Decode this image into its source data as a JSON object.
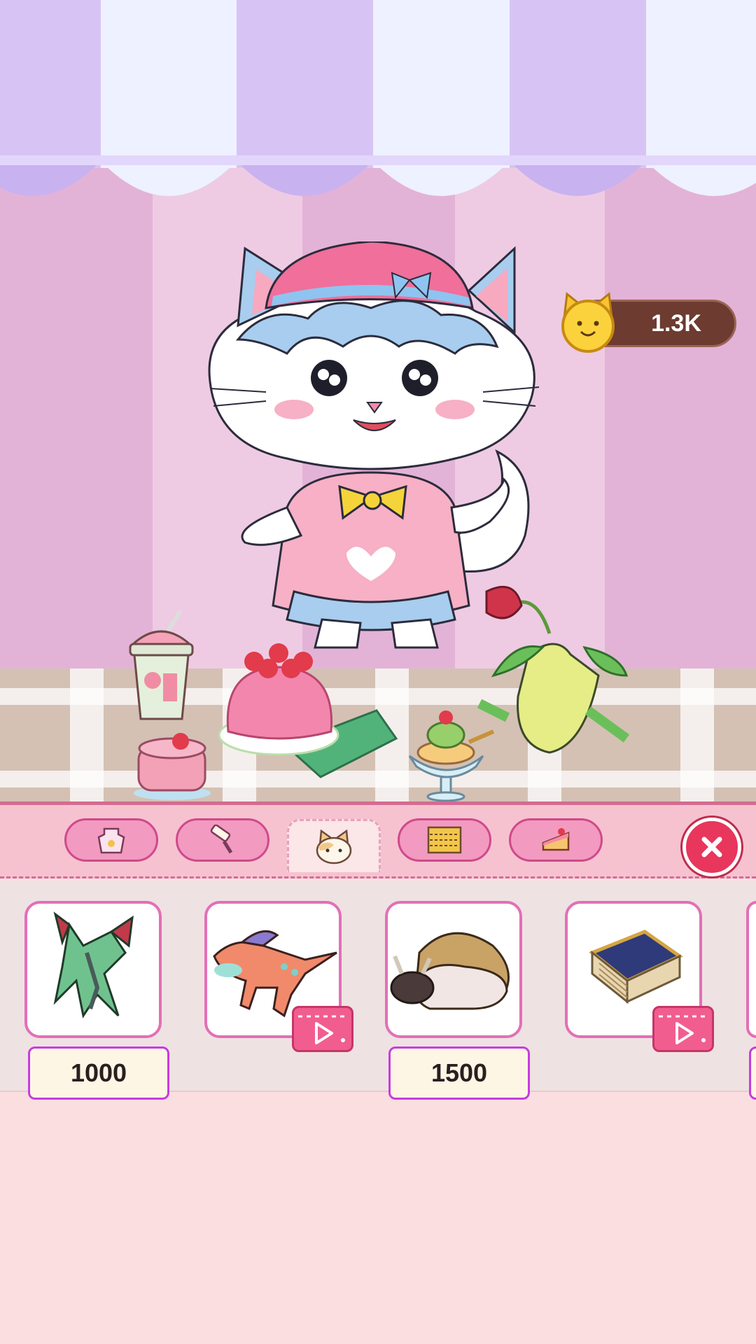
{
  "hud": {
    "coins": "1.3K",
    "coin_icon": "cat-coin-icon"
  },
  "tabs": [
    {
      "id": "apron",
      "icon": "apron-icon",
      "active": false
    },
    {
      "id": "roller",
      "icon": "paint-roller-icon",
      "active": false
    },
    {
      "id": "pets",
      "icon": "cat-face-icon",
      "active": true
    },
    {
      "id": "floor",
      "icon": "floor-pattern-icon",
      "active": false
    },
    {
      "id": "food",
      "icon": "cake-slice-icon",
      "active": false
    }
  ],
  "close_icon": "close-icon",
  "items": [
    {
      "name": "green-dragon",
      "price": "1000",
      "video": false
    },
    {
      "name": "orange-raptor",
      "price": "",
      "video": true
    },
    {
      "name": "armored-bison",
      "price": "1500",
      "video": false
    },
    {
      "name": "spellbook",
      "price": "",
      "video": true
    }
  ],
  "colors": {
    "accent": "#e36fb7",
    "tab": "#f29ac0",
    "close": "#e8365c",
    "coin_pill": "#6d3b30"
  }
}
